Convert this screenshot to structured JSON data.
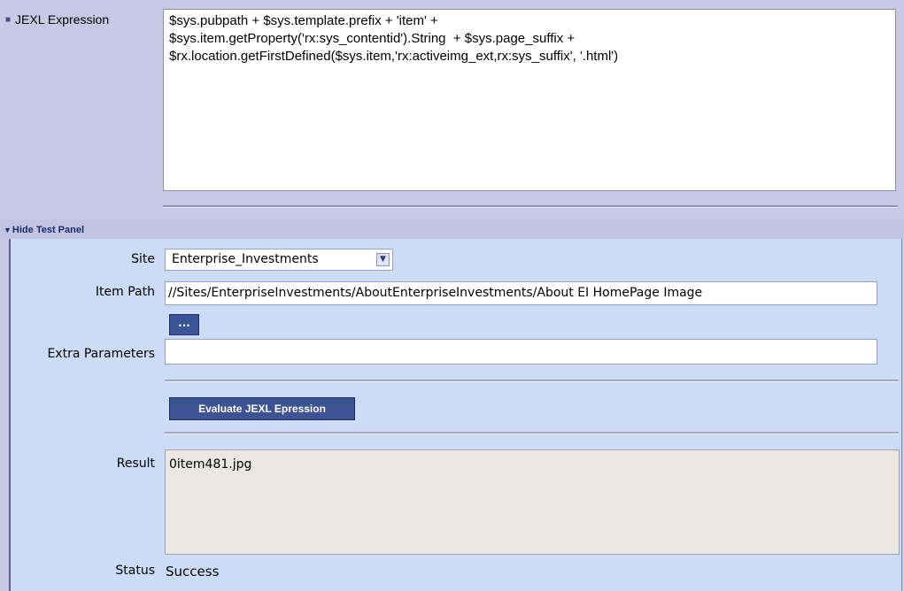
{
  "jexl": {
    "label": "JEXL Expression",
    "expression": "$sys.pubpath + $sys.template.prefix + 'item' +\n$sys.item.getProperty('rx:sys_contentid').String  + $sys.page_suffix +\n$rx.location.getFirstDefined($sys.item,'rx:activeimg_ext,rx:sys_suffix', '.html')"
  },
  "test_panel": {
    "toggle_label": "Hide Test Panel",
    "site_label": "Site",
    "site_value": "Enterprise_Investments",
    "item_path_label": "Item Path",
    "item_path_value": "//Sites/EnterpriseInvestments/AboutEnterpriseInvestments/About EI HomePage Image",
    "browse_label": "...",
    "extra_params_label": "Extra Parameters",
    "extra_params_value": "",
    "evaluate_label": "Evaluate JEXL Epression",
    "result_label": "Result",
    "result_value": "0item481.jpg",
    "status_label": "Status",
    "status_value": "Success"
  }
}
